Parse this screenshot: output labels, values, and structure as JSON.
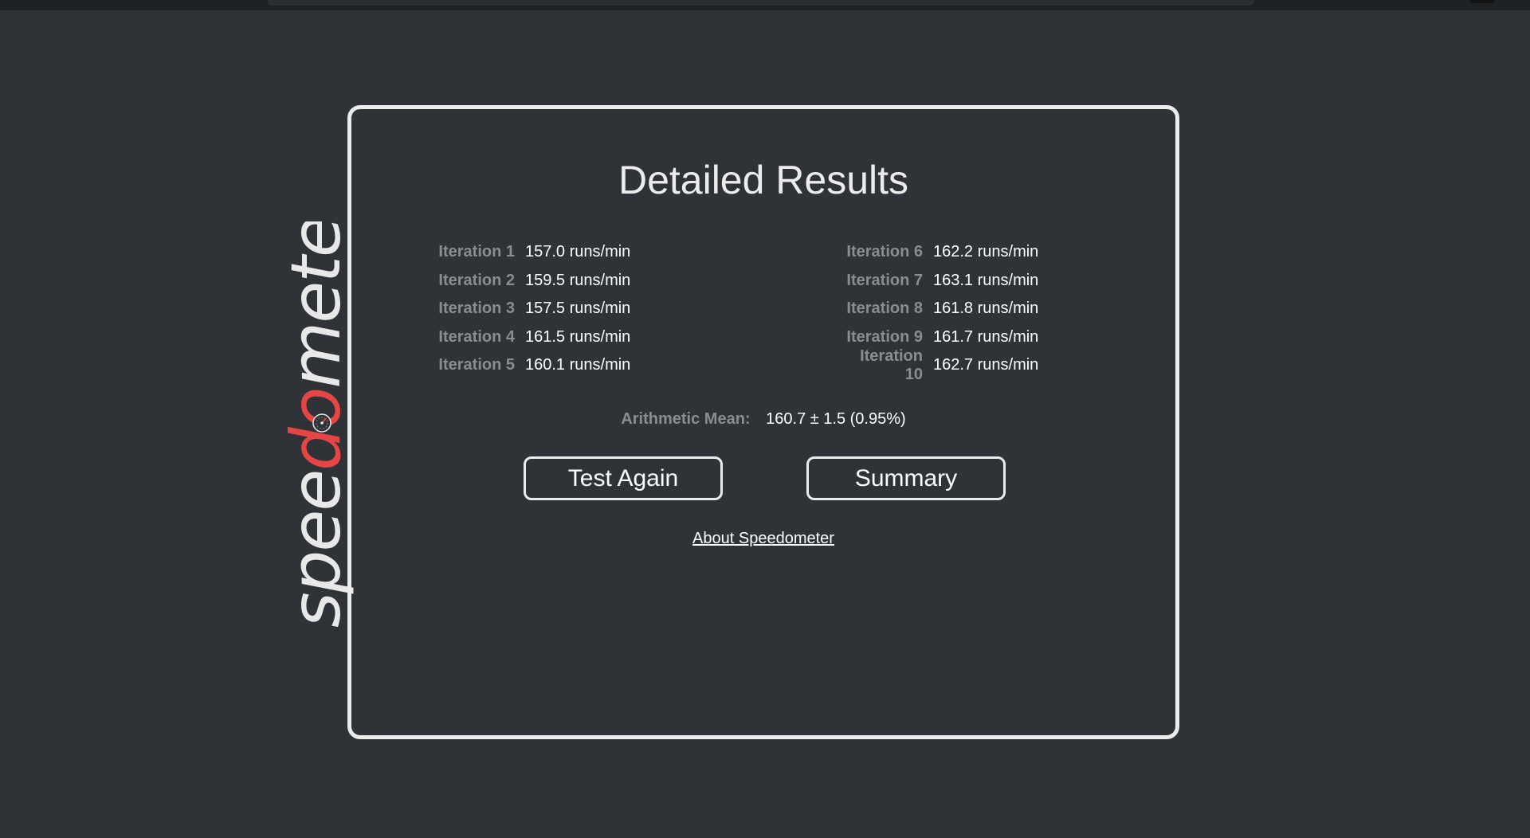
{
  "app": {
    "logo_prefix": "spee",
    "logo_accent": "do",
    "logo_suffix": "meter",
    "accent_color": "#e64545",
    "logo_color": "#e8e8e8"
  },
  "results": {
    "title": "Detailed Results",
    "left_column": [
      {
        "label": "Iteration 1",
        "value": "157.0 runs/min"
      },
      {
        "label": "Iteration 2",
        "value": "159.5 runs/min"
      },
      {
        "label": "Iteration 3",
        "value": "157.5 runs/min"
      },
      {
        "label": "Iteration 4",
        "value": "161.5 runs/min"
      },
      {
        "label": "Iteration 5",
        "value": "160.1 runs/min"
      }
    ],
    "right_column": [
      {
        "label": "Iteration 6",
        "value": "162.2 runs/min"
      },
      {
        "label": "Iteration 7",
        "value": "163.1 runs/min"
      },
      {
        "label": "Iteration 8",
        "value": "161.8 runs/min"
      },
      {
        "label": "Iteration 9",
        "value": "161.7 runs/min"
      },
      {
        "label": "Iteration 10",
        "value": "162.7 runs/min"
      }
    ],
    "mean_label": "Arithmetic Mean:",
    "mean_value": "160.7 ± 1.5 (0.95%)"
  },
  "actions": {
    "test_again_label": "Test Again",
    "summary_label": "Summary",
    "about_link": "About Speedometer"
  },
  "icons": {
    "logo_gauge": "speedometer-gauge-icon"
  }
}
